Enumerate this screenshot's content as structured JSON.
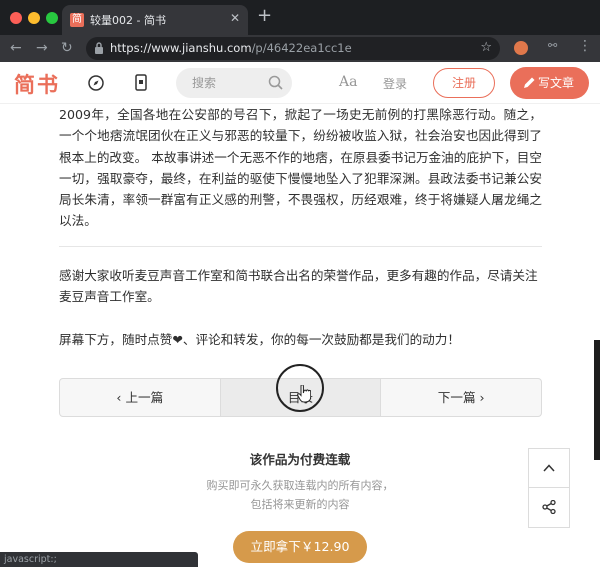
{
  "browser": {
    "tab_title": "较量002 - 简书",
    "favicon": "简",
    "url_host": "https://www.jianshu.com",
    "url_path": "/p/46422ea1cc1e",
    "status_text": "javascript:;"
  },
  "header": {
    "logo": "简书",
    "search_placeholder": "搜索",
    "font_toggle": "Aa",
    "login_label": "登录",
    "signup_label": "注册",
    "write_label": "写文章",
    "accent_color": "#ea6f5a"
  },
  "article": {
    "paragraph": "2009年，全国各地在公安部的号召下，掀起了一场史无前例的打黑除恶行动。随之，一个个地痞流氓团伙在正义与邪恶的较量下，纷纷被收监入狱，社会治安也因此得到了根本上的改变。 本故事讲述一个无恶不作的地痞，在原县委书记万金油的庇护下，目空一切，强取豪夺，最终，在利益的驱使下慢慢地坠入了犯罪深渊。县政法委书记兼公安局长朱清，率领一群富有正义感的刑警，不畏强权，历经艰难，终于将嫌疑人屠龙绳之以法。",
    "thanks": "感谢大家收听麦豆声音工作室和简书联合出名的荣誉作品，更多有趣的作品，尽请关注麦豆声音工作室。",
    "cta": "屏幕下方，随时点赞❤、评论和转发，你的每一次鼓励都是我们的动力！"
  },
  "pager": {
    "prev": "‹ 上一篇",
    "toc": "目录",
    "next": "下一篇 ›"
  },
  "paid": {
    "title": "该作品为付费连载",
    "desc_line1": "购买即可永久获取连载内的所有内容，",
    "desc_line2": "包括将来更新的内容",
    "buy_label": "立即拿下￥12.90",
    "buy_color": "#d69a4b"
  }
}
